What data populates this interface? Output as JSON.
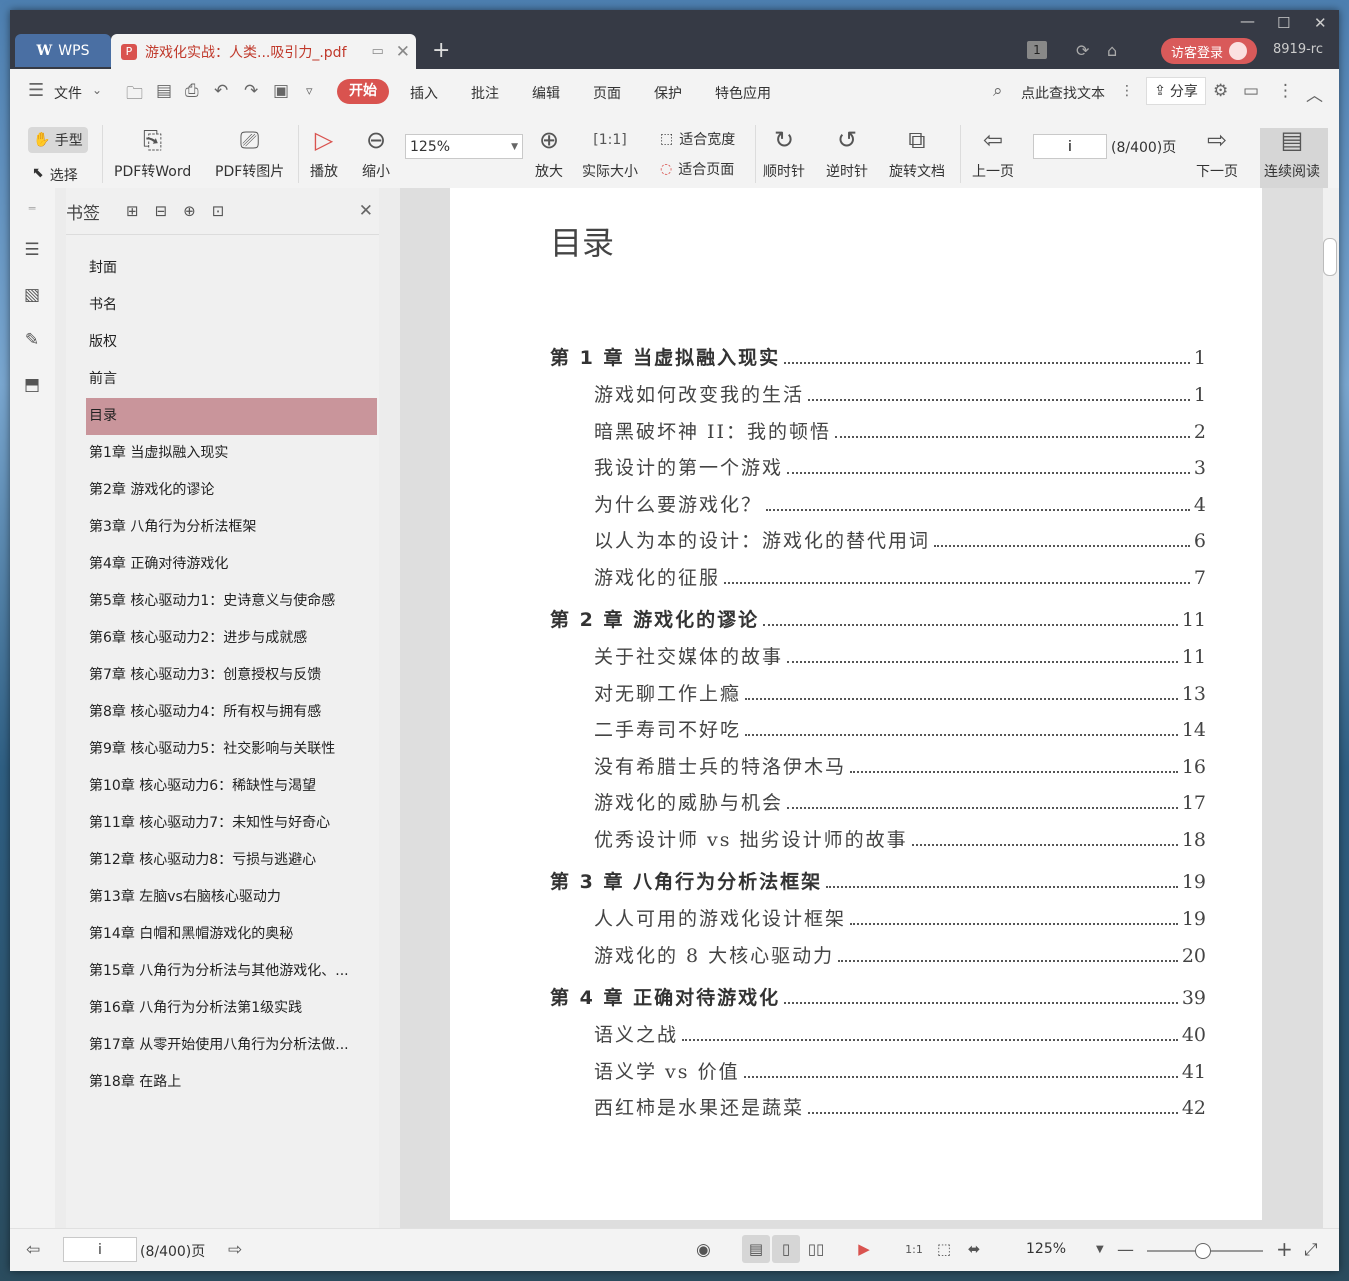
{
  "titlebar": {
    "app_tab": "WPS",
    "doc_tab_title": "游戏化实战：人类...吸引力_.pdf",
    "badge_count": "1",
    "guest_login": "访客登录",
    "user_code": "8919-rc"
  },
  "menubar": {
    "file": "文件",
    "tabs": [
      "开始",
      "插入",
      "批注",
      "编辑",
      "页面",
      "保护",
      "特色应用"
    ],
    "search_placeholder": "点此查找文本",
    "share": "分享"
  },
  "toolbar": {
    "hand": "手型",
    "select": "选择",
    "pdf_to_word": "PDF转Word",
    "pdf_to_image": "PDF转图片",
    "play": "播放",
    "zoom_out": "缩小",
    "zoom_value": "125%",
    "zoom_in": "放大",
    "actual_size": "实际大小",
    "fit_width": "适合宽度",
    "fit_page": "适合页面",
    "clockwise": "顺时针",
    "counterclockwise": "逆时针",
    "rotate_doc": "旋转文档",
    "prev_page": "上一页",
    "page_value": "i",
    "page_total": "(8/400)页",
    "next_page": "下一页",
    "continuous": "连续阅读"
  },
  "bookmarks": {
    "title": "书签",
    "items": [
      {
        "label": "封面",
        "expandable": false,
        "active": false
      },
      {
        "label": "书名",
        "expandable": false,
        "active": false
      },
      {
        "label": "版权",
        "expandable": false,
        "active": false
      },
      {
        "label": "前言",
        "expandable": false,
        "active": false
      },
      {
        "label": "目录",
        "expandable": false,
        "active": true
      },
      {
        "label": "第1章  当虚拟融入现实",
        "expandable": true,
        "active": false
      },
      {
        "label": "第2章  游戏化的谬论",
        "expandable": true,
        "active": false
      },
      {
        "label": "第3章  八角行为分析法框架",
        "expandable": true,
        "active": false
      },
      {
        "label": "第4章  正确对待游戏化",
        "expandable": true,
        "active": false
      },
      {
        "label": "第5章  核心驱动力1：史诗意义与使命感",
        "expandable": true,
        "active": false
      },
      {
        "label": "第6章  核心驱动力2：进步与成就感",
        "expandable": true,
        "active": false
      },
      {
        "label": "第7章  核心驱动力3：创意授权与反馈",
        "expandable": true,
        "active": false
      },
      {
        "label": "第8章  核心驱动力4：所有权与拥有感",
        "expandable": true,
        "active": false
      },
      {
        "label": "第9章  核心驱动力5：社交影响与关联性",
        "expandable": true,
        "active": false
      },
      {
        "label": "第10章  核心驱动力6：稀缺性与渴望",
        "expandable": true,
        "active": false
      },
      {
        "label": "第11章  核心驱动力7：未知性与好奇心",
        "expandable": true,
        "active": false
      },
      {
        "label": "第12章  核心驱动力8：亏损与逃避心",
        "expandable": true,
        "active": false
      },
      {
        "label": "第13章  左脑vs右脑核心驱动力",
        "expandable": true,
        "active": false
      },
      {
        "label": "第14章  白帽和黑帽游戏化的奥秘",
        "expandable": true,
        "active": false
      },
      {
        "label": "第15章  八角行为分析法与其他游戏化、...",
        "expandable": true,
        "active": false
      },
      {
        "label": "第16章  八角行为分析法第1级实践",
        "expandable": true,
        "active": false
      },
      {
        "label": "第17章  从零开始使用八角行为分析法做...",
        "expandable": true,
        "active": false
      },
      {
        "label": "第18章  在路上",
        "expandable": false,
        "active": false
      }
    ]
  },
  "document": {
    "toc_title": "目录",
    "entries": [
      {
        "text": "第 1 章   当虚拟融入现实",
        "page": "1",
        "chapter": true
      },
      {
        "text": "游戏如何改变我的生活",
        "page": "1",
        "chapter": false
      },
      {
        "text": "暗黑破坏神 II：我的顿悟",
        "page": "2",
        "chapter": false
      },
      {
        "text": "我设计的第一个游戏",
        "page": "3",
        "chapter": false
      },
      {
        "text": "为什么要游戏化？",
        "page": "4",
        "chapter": false
      },
      {
        "text": "以人为本的设计：游戏化的替代用词",
        "page": "6",
        "chapter": false
      },
      {
        "text": "游戏化的征服",
        "page": "7",
        "chapter": false
      },
      {
        "text": "第 2 章   游戏化的谬论",
        "page": "11",
        "chapter": true
      },
      {
        "text": "关于社交媒体的故事",
        "page": "11",
        "chapter": false
      },
      {
        "text": "对无聊工作上瘾",
        "page": "13",
        "chapter": false
      },
      {
        "text": "二手寿司不好吃",
        "page": "14",
        "chapter": false
      },
      {
        "text": "没有希腊士兵的特洛伊木马",
        "page": "16",
        "chapter": false
      },
      {
        "text": "游戏化的威胁与机会",
        "page": "17",
        "chapter": false
      },
      {
        "text": "优秀设计师 vs 拙劣设计师的故事",
        "page": "18",
        "chapter": false
      },
      {
        "text": "第 3 章   八角行为分析法框架",
        "page": "19",
        "chapter": true
      },
      {
        "text": "人人可用的游戏化设计框架",
        "page": "19",
        "chapter": false
      },
      {
        "text": "游戏化的 8 大核心驱动力",
        "page": "20",
        "chapter": false
      },
      {
        "text": "第 4 章   正确对待游戏化",
        "page": "39",
        "chapter": true
      },
      {
        "text": "语义之战",
        "page": "40",
        "chapter": false
      },
      {
        "text": "语义学 vs 价值",
        "page": "41",
        "chapter": false
      },
      {
        "text": "西红柿是水果还是蔬菜",
        "page": "42",
        "chapter": false
      }
    ]
  },
  "statusbar": {
    "page_value": "i",
    "page_total": "(8/400)页",
    "zoom": "125%"
  },
  "colors": {
    "accent": "#d9534f",
    "titlebar": "#363a45",
    "active_bookmark": "#c9959b"
  }
}
